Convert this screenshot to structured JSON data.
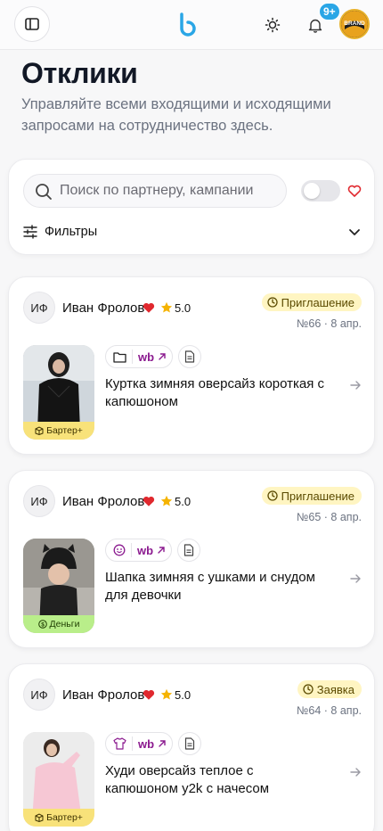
{
  "header": {
    "sidebar_icon": "sidebar-toggle-icon",
    "logo_icon": "brand-logo-icon",
    "theme_icon": "sun-icon",
    "notifications_badge": "9+",
    "avatar_text": "BRAND"
  },
  "page": {
    "title": "Отклики",
    "subtitle": "Управляйте всеми входящими и исходящими запросами на сотрудничество здесь."
  },
  "search": {
    "placeholder": "Поиск по партнеру, кампании",
    "value": "",
    "favorites_only": false,
    "filters_label": "Фильтры"
  },
  "colors": {
    "invite_badge_bg": "#fff5c2",
    "barter_label_bg": "#f8e27a",
    "money_label_bg": "#b9ee8a",
    "wb_color": "#8b1a8f",
    "heart": "#e0282e",
    "star": "#f5b301",
    "notification_badge": "#2aa6e6"
  },
  "responses": [
    {
      "initials": "ИФ",
      "partner": "Иван Фролов",
      "rating": "5.0",
      "status": "Приглашение",
      "number": "№66",
      "date": "8 апр.",
      "marketplace": "wb",
      "category_icon": "folder-icon",
      "product": "Куртка зимняя оверсайз короткая с капюшоном",
      "deal_type": "Бартер+"
    },
    {
      "initials": "ИФ",
      "partner": "Иван Фролов",
      "rating": "5.0",
      "status": "Приглашение",
      "number": "№65",
      "date": "8 апр.",
      "marketplace": "wb",
      "category_icon": "baby-face-icon",
      "product": "Шапка зимняя с ушками и снудом для девочки",
      "deal_type": "Деньги"
    },
    {
      "initials": "ИФ",
      "partner": "Иван Фролов",
      "rating": "5.0",
      "status": "Заявка",
      "number": "№64",
      "date": "8 апр.",
      "marketplace": "wb",
      "category_icon": "tshirt-icon",
      "product": "Худи оверсайз теплое с капюшоном y2k с начесом",
      "deal_type": "Бартер+"
    }
  ]
}
